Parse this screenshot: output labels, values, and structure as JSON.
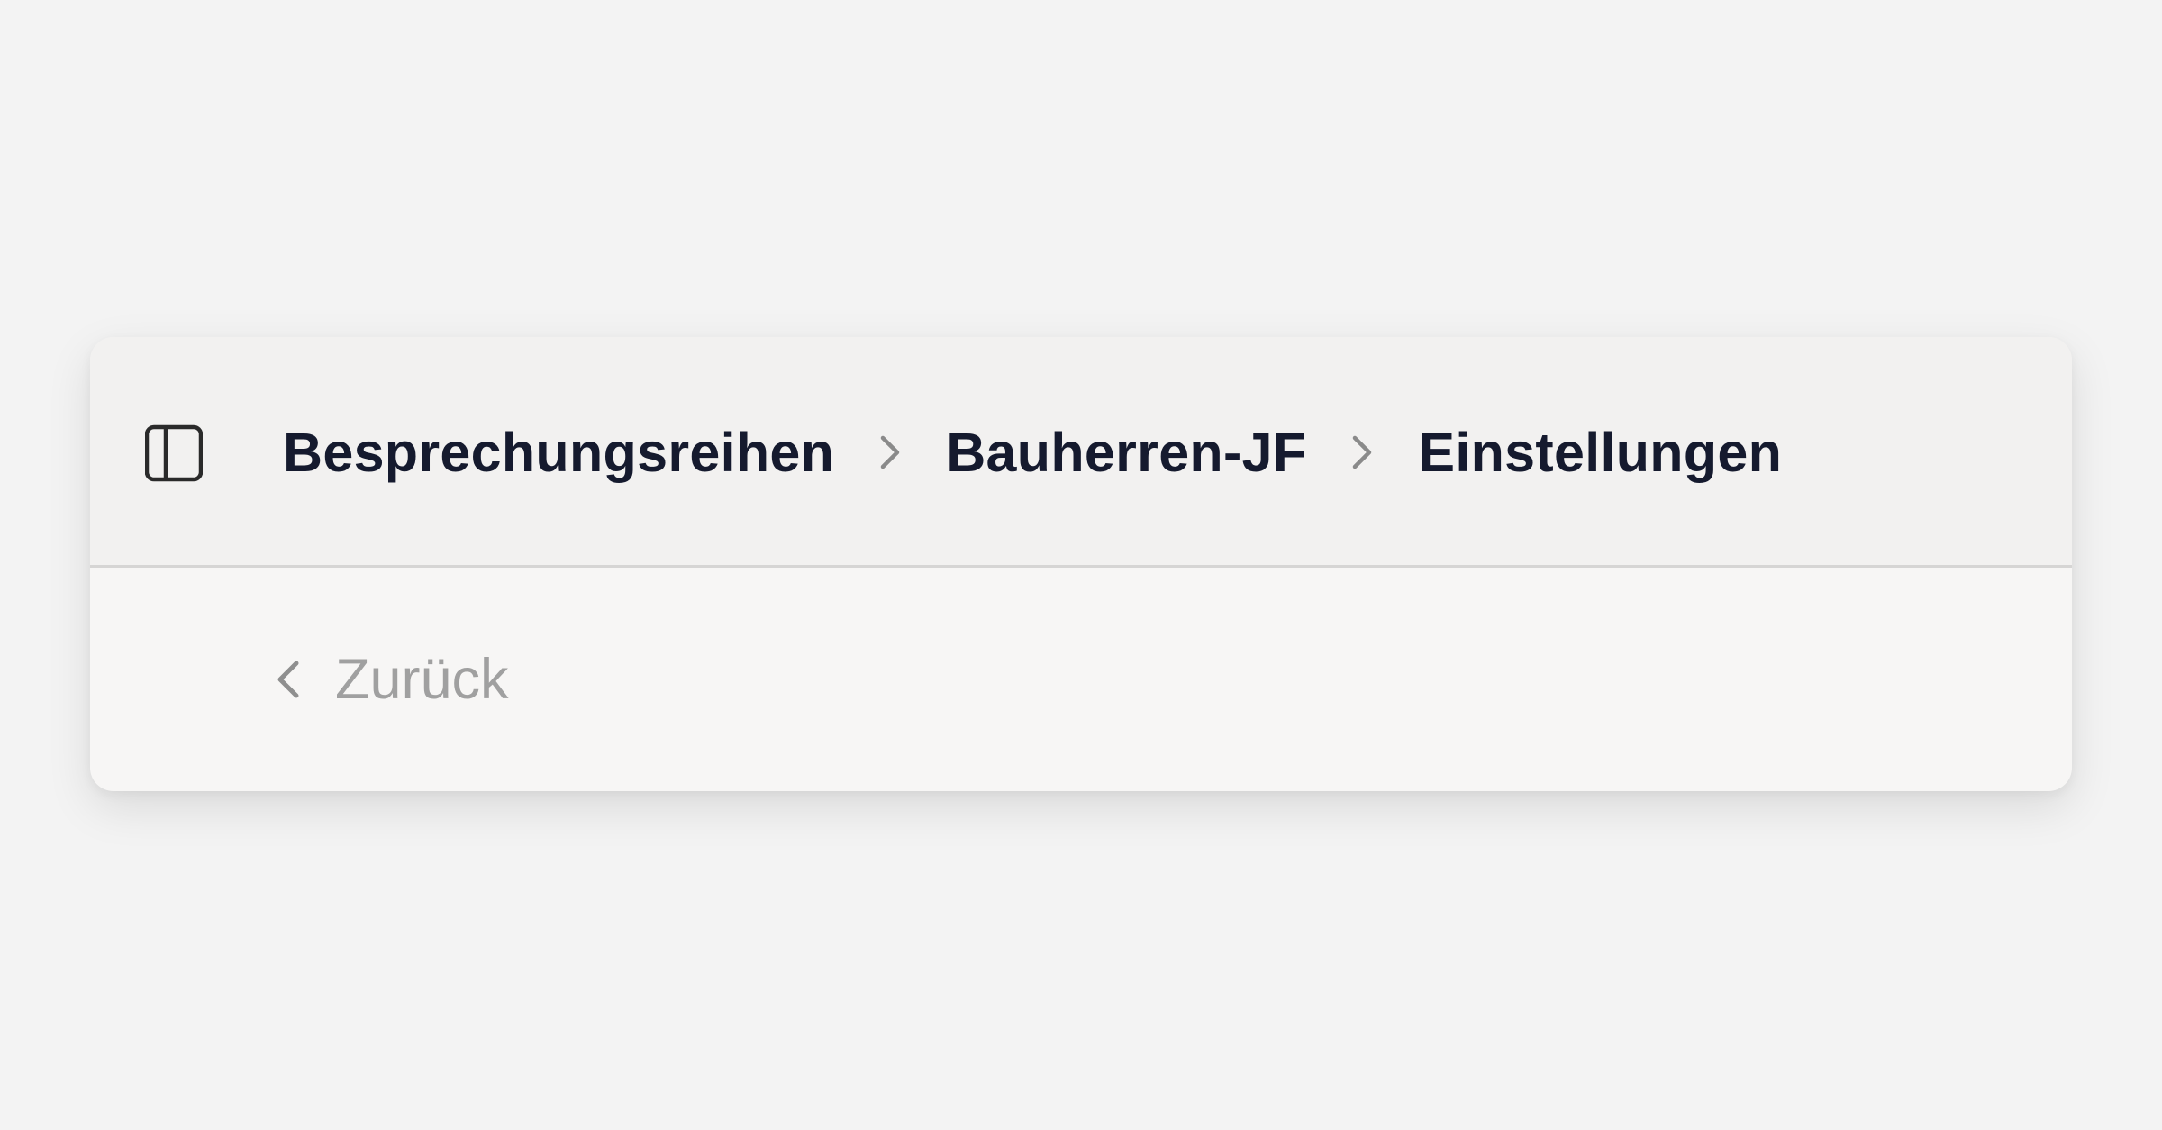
{
  "header": {
    "sidebar_toggle_icon": "sidebar-panel-icon",
    "breadcrumb": [
      {
        "label": "Besprechungsreihen"
      },
      {
        "label": "Bauherren-JF"
      },
      {
        "label": "Einstellungen"
      }
    ],
    "separator_icon": "chevron-right-icon"
  },
  "content": {
    "back_label": "Zurück",
    "back_icon": "chevron-left-icon"
  },
  "colors": {
    "page_background": "#f3f3f3",
    "card_background": "#f7f6f5",
    "breadcrumb_text": "#151a2e",
    "back_text": "#a0a0a0"
  }
}
